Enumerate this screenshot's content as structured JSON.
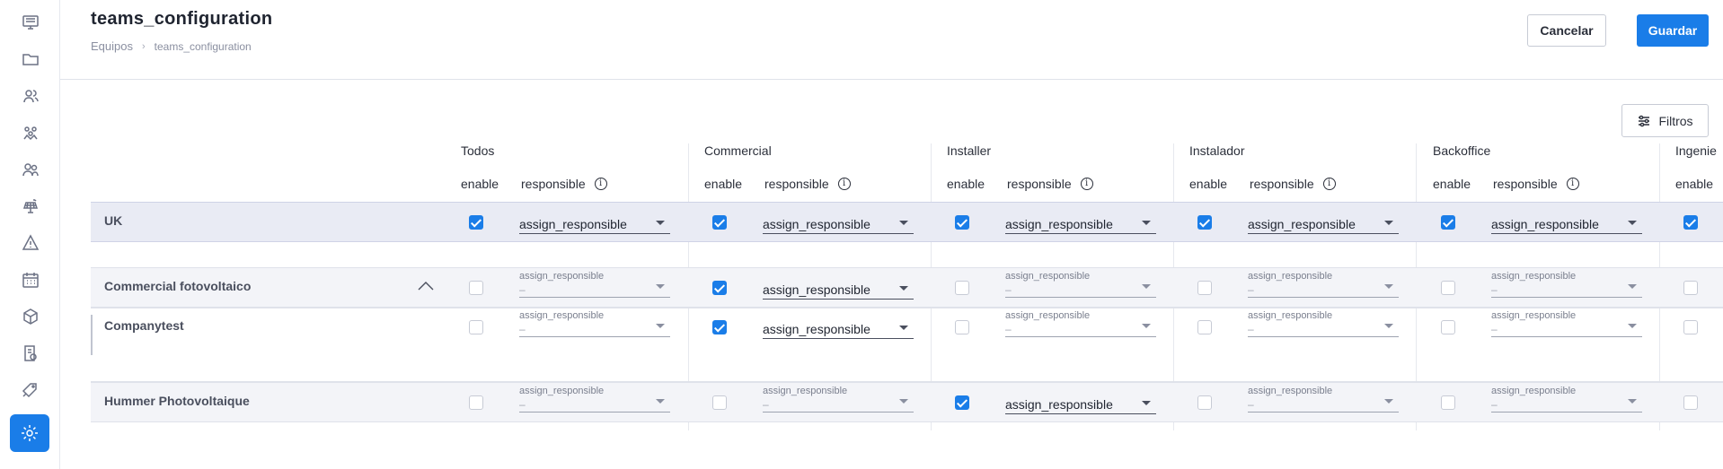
{
  "header": {
    "title": "teams_configuration",
    "breadcrumb": [
      "Equipos",
      "teams_configuration"
    ],
    "cancel_label": "Cancelar",
    "save_label": "Guardar"
  },
  "toolbar": {
    "filter_label": "Filtros"
  },
  "sidebar": {
    "items": [
      {
        "icon": "monitor-icon"
      },
      {
        "icon": "folder-icon"
      },
      {
        "icon": "user-group-icon"
      },
      {
        "icon": "team-icon"
      },
      {
        "icon": "users-icon"
      },
      {
        "icon": "solar-panel-icon"
      },
      {
        "icon": "warning-icon"
      },
      {
        "icon": "calendar-icon"
      },
      {
        "icon": "box-icon"
      },
      {
        "icon": "invoice-icon"
      },
      {
        "icon": "tag-icon"
      },
      {
        "icon": "gear-icon",
        "active": true
      }
    ],
    "accent": "#1a7de8"
  },
  "table": {
    "sub_enable": "enable",
    "sub_responsible": "responsible",
    "select_label": "assign_responsible",
    "select_placeholder": "–",
    "columns": [
      "Todos",
      "Commercial",
      "Installer",
      "Instalador",
      "Backoffice",
      "Ingenie"
    ],
    "rows": [
      {
        "name": "UK",
        "enabled": [
          true,
          true,
          true,
          true,
          true,
          true
        ]
      },
      {
        "name": "Commercial fotovoltaico",
        "enabled": [
          false,
          true,
          false,
          false,
          false,
          false
        ]
      },
      {
        "name": "Companytest",
        "enabled": [
          false,
          true,
          false,
          false,
          false,
          false
        ]
      },
      {
        "name": "Hummer Photovoltaique",
        "enabled": [
          false,
          false,
          true,
          false,
          false,
          false
        ]
      }
    ]
  }
}
